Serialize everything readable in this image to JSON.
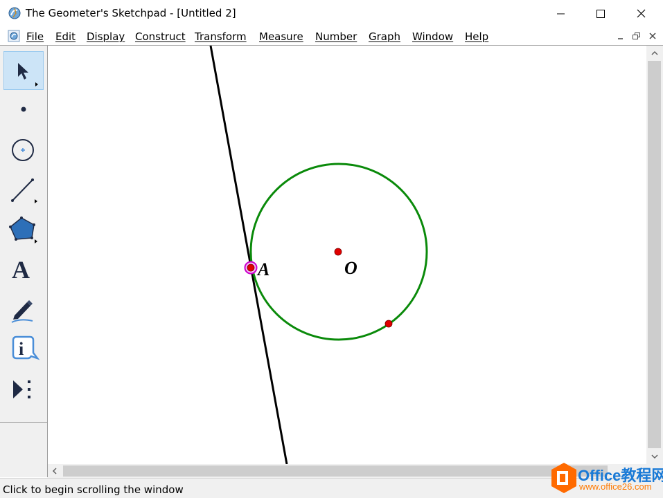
{
  "window": {
    "title": "The Geometer's Sketchpad - [Untitled 2]",
    "controls": [
      "minimize",
      "maximize",
      "close"
    ]
  },
  "menu": {
    "items": [
      "File",
      "Edit",
      "Display",
      "Construct",
      "Transform",
      "Measure",
      "Number",
      "Graph",
      "Window",
      "Help"
    ]
  },
  "toolbox": {
    "tools": [
      {
        "name": "arrow-select-tool",
        "icon": "arrow-icon",
        "active": true
      },
      {
        "name": "point-tool",
        "icon": "point-icon"
      },
      {
        "name": "compass-tool",
        "icon": "circle-icon"
      },
      {
        "name": "straightedge-tool",
        "icon": "segment-icon"
      },
      {
        "name": "polygon-tool",
        "icon": "polygon-icon"
      },
      {
        "name": "text-tool",
        "icon": "letter-a-icon",
        "glyph": "A"
      },
      {
        "name": "marker-tool",
        "icon": "marker-icon"
      },
      {
        "name": "information-tool",
        "icon": "info-icon",
        "glyph": "i"
      },
      {
        "name": "custom-tool",
        "icon": "custom-tool-icon"
      }
    ]
  },
  "sketch": {
    "labels": {
      "point_a": "A",
      "center_o": "O"
    },
    "colors": {
      "circle": "#0a8a0a",
      "line": "#000000",
      "point": "#e00000",
      "selection": "#cc00cc"
    }
  },
  "status": {
    "text": "Click to begin scrolling the window"
  },
  "watermark": {
    "title": "Office教程网",
    "url": "www.office26.com",
    "colors": {
      "orange": "#ff6a00",
      "blue": "#1a7ad6"
    }
  }
}
